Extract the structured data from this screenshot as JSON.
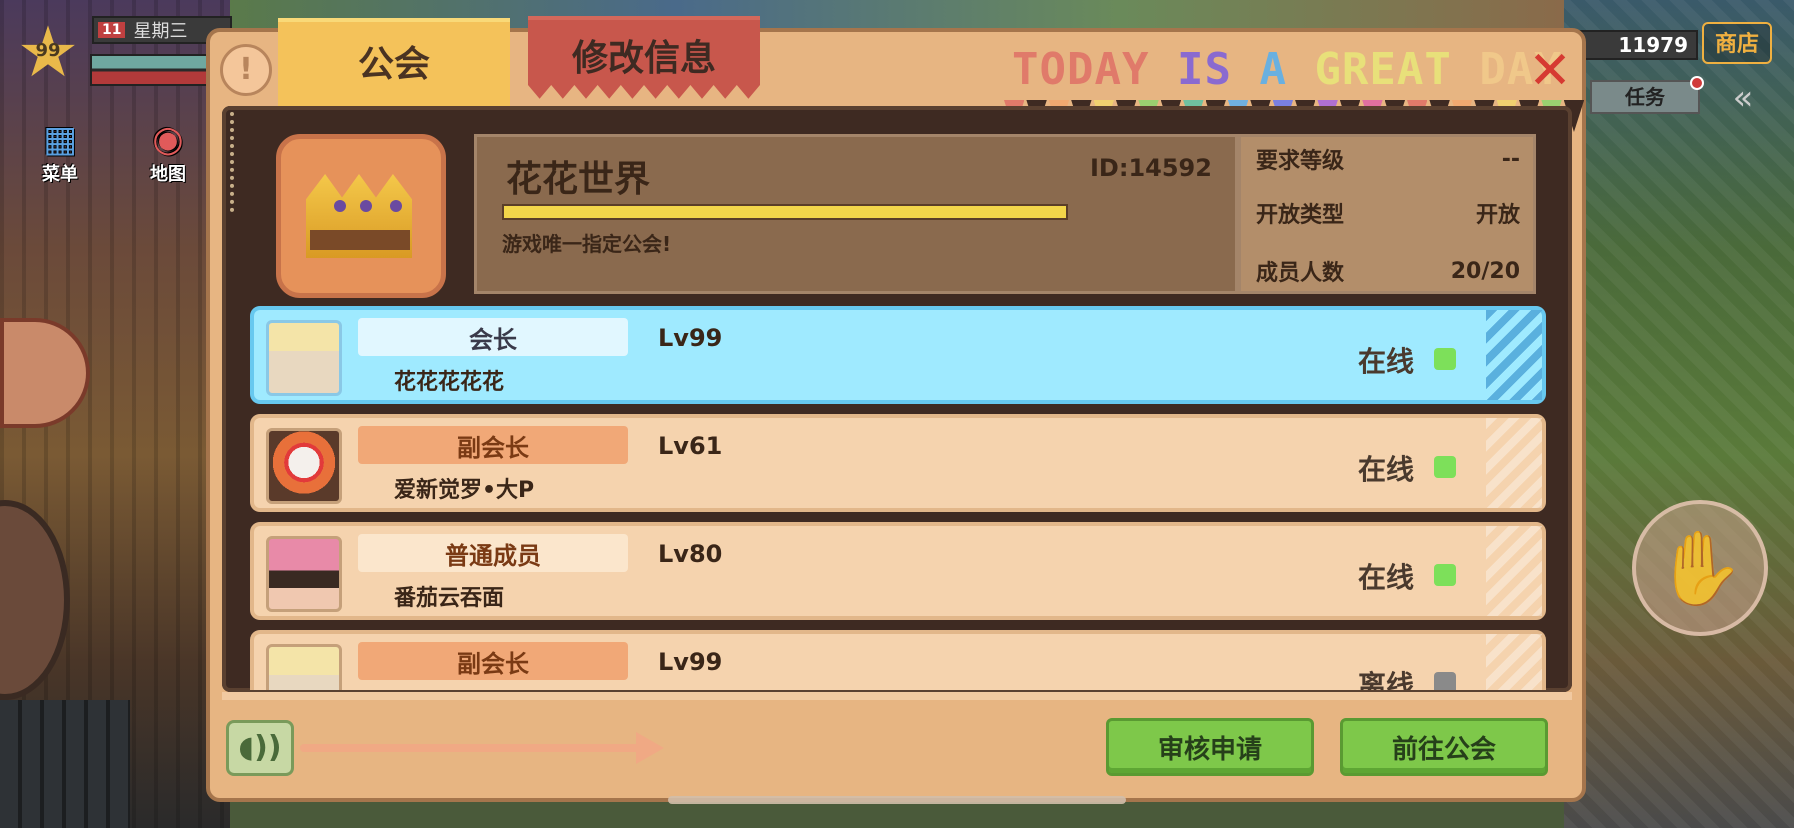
{
  "hud": {
    "level": "99",
    "date_day": "11",
    "weekday": "星期三",
    "menu_label": "菜单",
    "map_label": "地图",
    "coins": "11979",
    "shop_label": "商店",
    "task_label": "任务"
  },
  "tabs": {
    "guild": "公会",
    "edit": "修改信息"
  },
  "banner": {
    "words": [
      {
        "text": "TODAY",
        "color": "#e07a6a"
      },
      {
        "text": "IS",
        "color": "#8a6ad0"
      },
      {
        "text": "A",
        "color": "#6ab0e0"
      },
      {
        "text": "GREAT",
        "color": "#e8e07a"
      },
      {
        "text": "DAY",
        "color": "#f0c88a"
      }
    ],
    "flag_colors": [
      "#e07a6a",
      "#f0a870",
      "#f0d070",
      "#9ad070",
      "#70c0a0",
      "#70b0e0",
      "#7a80e0",
      "#b070d0",
      "#e070a0",
      "#e07a6a",
      "#f0a870",
      "#f0d070",
      "#9ad070"
    ]
  },
  "guild": {
    "name": "花花世界",
    "id": "ID:14592",
    "progress": 1.0,
    "motto": "游戏唯一指定公会!",
    "stats": [
      {
        "label": "要求等级",
        "value": "--"
      },
      {
        "label": "开放类型",
        "value": "开放"
      },
      {
        "label": "成员人数",
        "value": "20/20"
      }
    ]
  },
  "members": [
    {
      "role": "会长",
      "name": "花花花花花",
      "level": "Lv99",
      "status": "在线",
      "online": true,
      "role_type": "leader",
      "avatar": "elf-avatar"
    },
    {
      "role": "副会长",
      "name": "爱新觉罗•大P",
      "level": "Lv61",
      "status": "在线",
      "online": true,
      "role_type": "vice",
      "avatar": "clown-avatar"
    },
    {
      "role": "普通成员",
      "name": "番茄云吞面",
      "level": "Lv80",
      "status": "在线",
      "online": true,
      "role_type": "member",
      "avatar": "pink-hood-avatar"
    },
    {
      "role": "副会长",
      "name": "",
      "level": "Lv99",
      "status": "离线",
      "online": false,
      "role_type": "vice",
      "avatar": "elf-avatar"
    }
  ],
  "buttons": {
    "review": "审核申请",
    "goto": "前往公会"
  },
  "colors": {
    "online": "#7de05a",
    "offline": "#8a8a8a",
    "leader_row": "#9feaff",
    "member_row": "#f5d3ae",
    "primary_button": "#7ec84a"
  }
}
